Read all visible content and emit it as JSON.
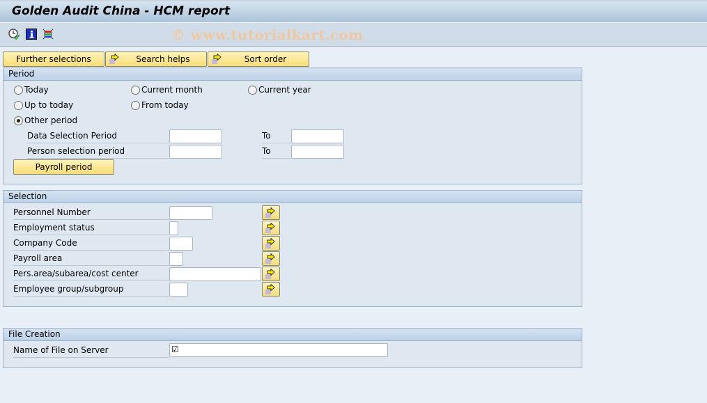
{
  "window": {
    "title": "Golden Audit China - HCM report",
    "watermark": "© www.tutorialkart.com"
  },
  "toolbar": {
    "icons": [
      "execute-background-icon",
      "info-icon",
      "variant-layout-icon"
    ]
  },
  "top_buttons": {
    "further_selections": "Further selections",
    "search_helps": "Search helps",
    "sort_order": "Sort order"
  },
  "period": {
    "title": "Period",
    "radios": {
      "today": "Today",
      "current_month": "Current month",
      "current_year": "Current year",
      "up_to_today": "Up to today",
      "from_today": "From today",
      "other_period": "Other period"
    },
    "selected": "other_period",
    "data_selection_label": "Data Selection Period",
    "person_selection_label": "Person selection period",
    "to_label": "To",
    "data_selection_from": "",
    "data_selection_to": "",
    "person_selection_from": "",
    "person_selection_to": "",
    "payroll_period_button": "Payroll period"
  },
  "selection": {
    "title": "Selection",
    "fields": [
      {
        "label": "Personnel Number",
        "value": ""
      },
      {
        "label": "Employment status",
        "value": ""
      },
      {
        "label": "Company Code",
        "value": ""
      },
      {
        "label": "Payroll area",
        "value": ""
      },
      {
        "label": "Pers.area/subarea/cost center",
        "value": ""
      },
      {
        "label": "Employee group/subgroup",
        "value": ""
      }
    ]
  },
  "file_creation": {
    "title": "File Creation",
    "file_label": "Name of File on Server",
    "file_value": "",
    "required_marker": "☑"
  }
}
